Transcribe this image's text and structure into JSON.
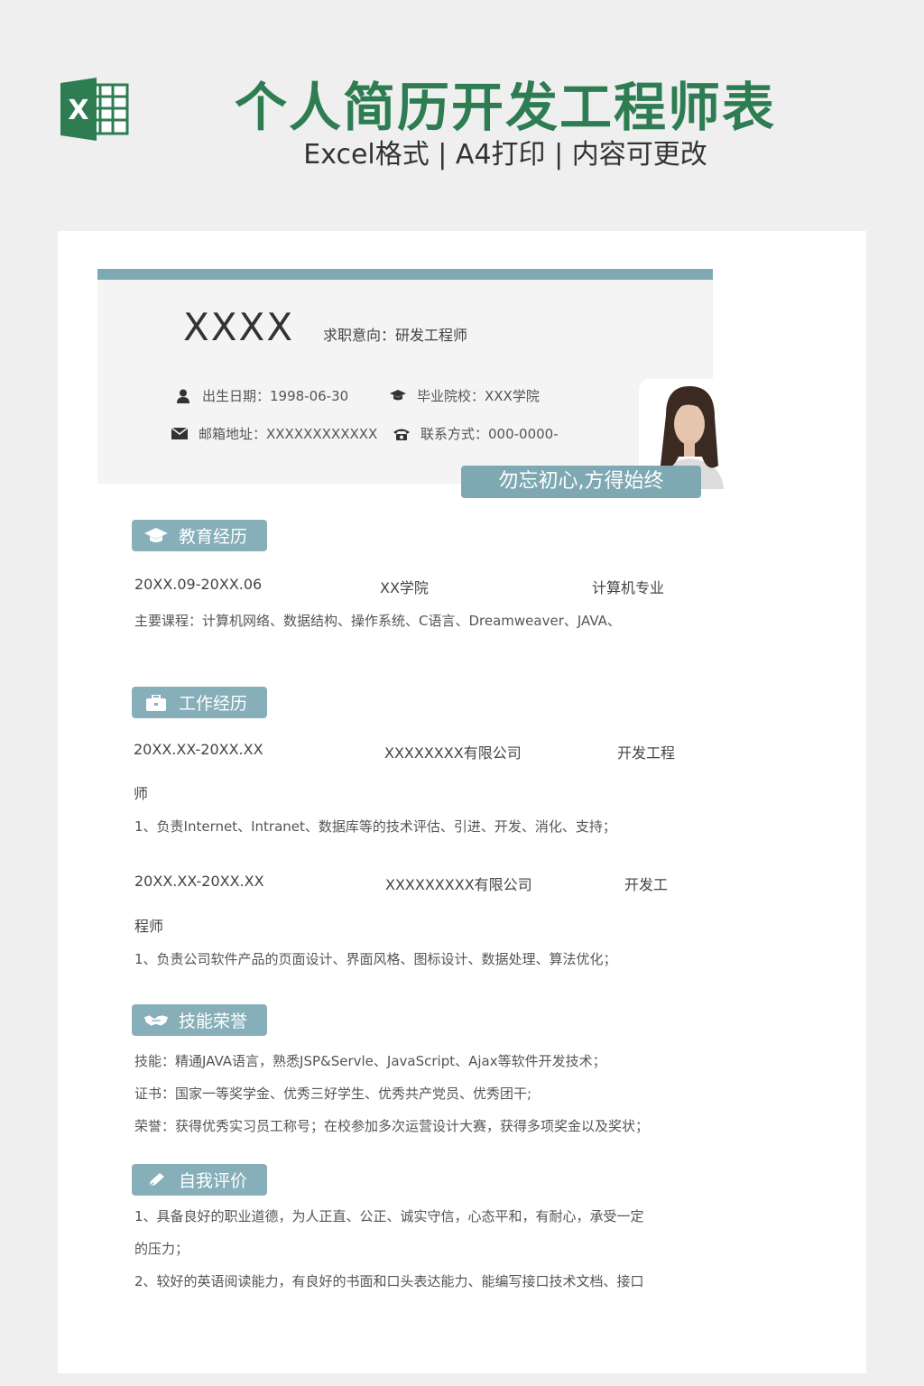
{
  "banner": {
    "title": "个人简历开发工程师表",
    "subtitle": "Excel格式 | A4打印 | 内容可更改",
    "logo_icon": "excel-icon",
    "logo_letter": "X"
  },
  "colors": {
    "accent": "#7ea9b3",
    "brand_green": "#2e7d52",
    "header_bg": "#f4f4f4"
  },
  "header": {
    "name": "XXXX",
    "job_intent": "求职意向：研发工程师",
    "birth": "出生日期：1998-06-30",
    "school": "毕业院校：XXX学院",
    "email": "邮箱地址：XXXXXXXXXXXX",
    "phone": "联系方式：000-0000-",
    "motto": "勿忘初心,方得始终"
  },
  "education": {
    "title": "教育经历",
    "date": "20XX.09-20XX.06",
    "school": "XX学院",
    "major": "计算机专业",
    "courses": "主要课程：计算机网络、数据结构、操作系统、C语言、Dreamweaver、JAVA、"
  },
  "work": {
    "title": "工作经历",
    "items": [
      {
        "date": "20XX.XX-20XX.XX",
        "company": "XXXXXXXX有限公司",
        "role_a": "开发工程",
        "role_b": "师",
        "desc": "1、负责Internet、Intranet、数据库等的技术评估、引进、开发、消化、支持；"
      },
      {
        "date": "20XX.XX-20XX.XX",
        "company": "XXXXXXXXX有限公司",
        "role_a": "开发工",
        "role_b": "程师",
        "desc": "1、负责公司软件产品的页面设计、界面风格、图标设计、数据处理、算法优化；"
      }
    ]
  },
  "skills": {
    "title": "技能荣誉",
    "skill": "技能：精通JAVA语言，熟悉JSP&Servle、JavaScript、Ajax等软件开发技术；",
    "cert": "证书：国家一等奖学金、优秀三好学生、优秀共产党员、优秀团干;",
    "honor": "荣誉：获得优秀实习员工称号；在校参加多次运营设计大赛，获得多项奖金以及奖状；"
  },
  "self_eval": {
    "title": "自我评价",
    "line1": "1、具备良好的职业道德，为人正直、公正、诚实守信，心态平和，有耐心，承受一定",
    "line2": "的压力；",
    "line3": "2、较好的英语阅读能力，有良好的书面和口头表达能力、能编写接口技术文档、接口"
  }
}
